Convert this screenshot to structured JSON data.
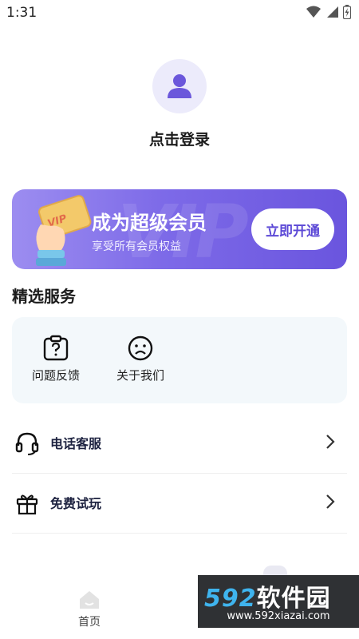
{
  "status_bar": {
    "time": "1:31"
  },
  "profile": {
    "login_text": "点击登录"
  },
  "vip": {
    "title": "成为超级会员",
    "subtitle": "享受所有会员权益",
    "button": "立即开通",
    "watermark": "VIP",
    "badge": "VIP"
  },
  "services": {
    "title": "精选服务",
    "items": [
      {
        "label": "问题反馈",
        "icon": "feedback-icon"
      },
      {
        "label": "关于我们",
        "icon": "about-icon"
      }
    ]
  },
  "list": [
    {
      "label": "电话客服",
      "icon": "headset-icon"
    },
    {
      "label": "免费试玩",
      "icon": "gift-icon"
    }
  ],
  "tabbar": {
    "home_label": "首页"
  },
  "watermark": {
    "brand": "592",
    "brand_cn": "软件园",
    "url": "www.592xiazai.com"
  },
  "colors": {
    "accent": "#6a55de",
    "vip_gradient_start": "#9c8df0",
    "service_bg": "#f3f8fb"
  }
}
